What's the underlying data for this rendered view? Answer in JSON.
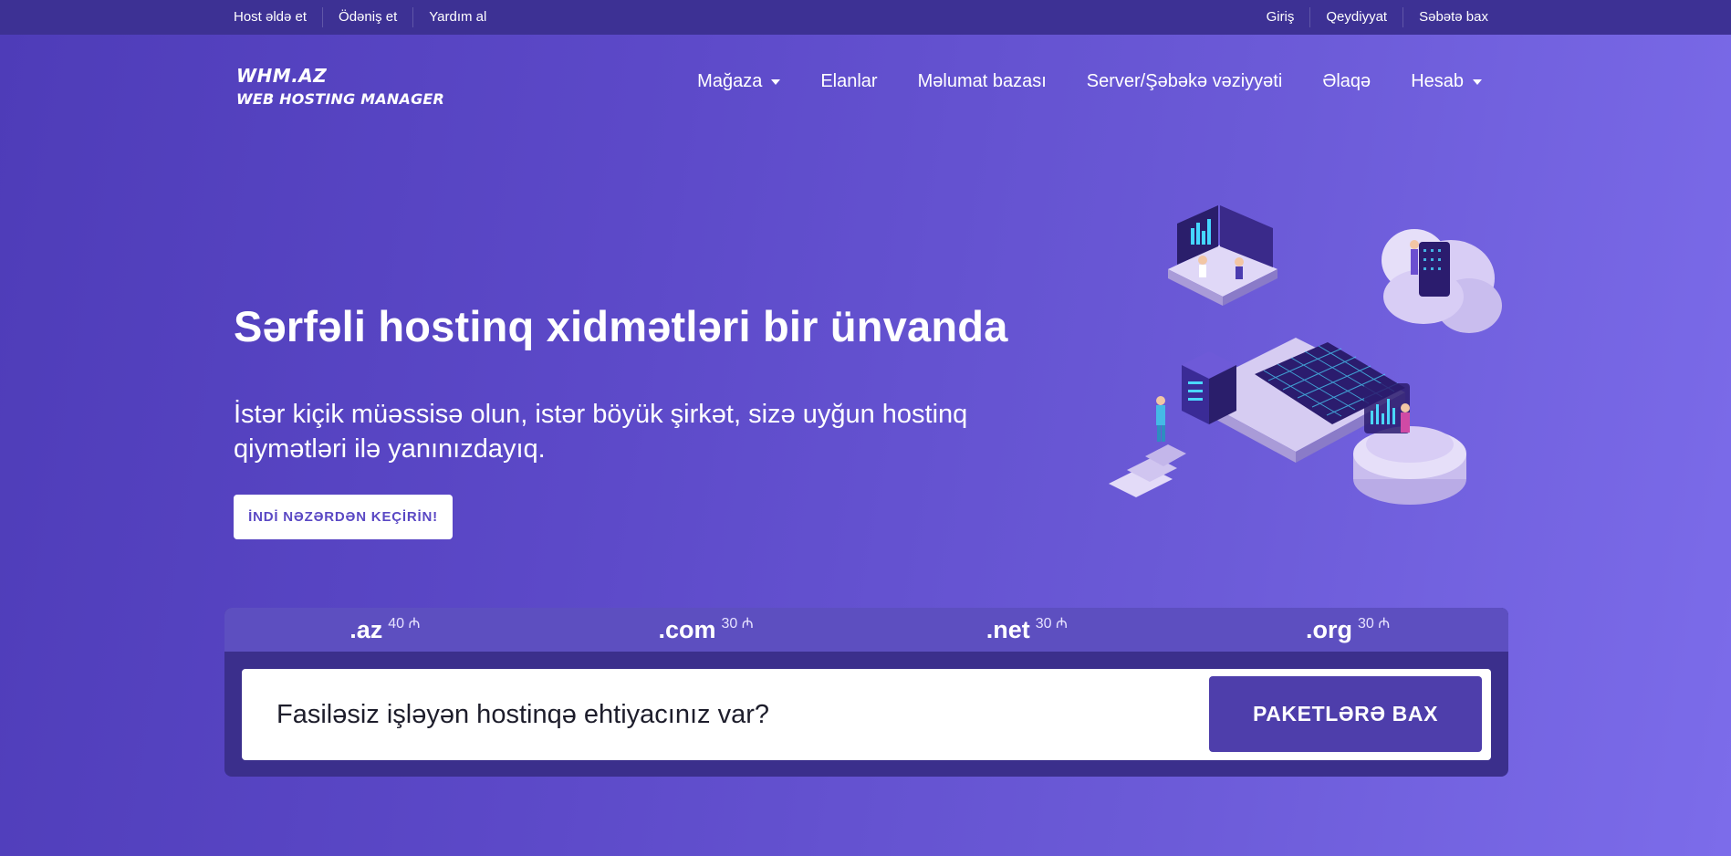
{
  "topbar": {
    "left_links": [
      "Host əldə et",
      "Ödəniş et",
      "Yardım al"
    ],
    "right_links": [
      "Giriş",
      "Qeydiyyat",
      "Səbətə bax"
    ]
  },
  "logo": {
    "line1": "WHM.AZ",
    "line2": "WEB HOSTING MANAGER"
  },
  "nav": {
    "items": [
      {
        "label": "Mağaza",
        "has_dropdown": true
      },
      {
        "label": "Elanlar",
        "has_dropdown": false
      },
      {
        "label": "Məlumat bazası",
        "has_dropdown": false
      },
      {
        "label": "Server/Şəbəkə vəziyyəti",
        "has_dropdown": false
      },
      {
        "label": "Əlaqə",
        "has_dropdown": false
      },
      {
        "label": "Hesab",
        "has_dropdown": true
      }
    ]
  },
  "hero": {
    "title": "Sərfəli hostinq xidmətləri bir ünvanda",
    "subtitle": "İstər kiçik müəssisə olun, istər böyük şirkət, sizə uyğun hostinq qiymətləri ilə yanınızdayıq.",
    "cta_label": "İNDİ NƏZƏRDƏN KEÇİRİN!"
  },
  "domains": [
    {
      "ext": ".az",
      "price": "40 ₼"
    },
    {
      "ext": ".com",
      "price": "30 ₼"
    },
    {
      "ext": ".net",
      "price": "30 ₼"
    },
    {
      "ext": ".org",
      "price": "30 ₼"
    }
  ],
  "search": {
    "text": "Fasiləsiz işləyən hostinqə ehtiyacınız var?",
    "button_label": "PAKETLƏRƏ BAX"
  },
  "colors": {
    "topbar_bg": "#3d3194",
    "accent": "#4e3eab",
    "gradient_start": "#4e3cb8",
    "gradient_end": "#7c6cea"
  }
}
